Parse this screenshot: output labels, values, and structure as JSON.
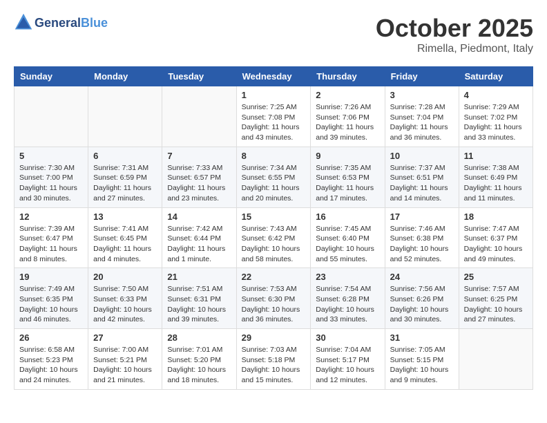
{
  "header": {
    "logo_line1": "General",
    "logo_line2": "Blue",
    "month": "October 2025",
    "location": "Rimella, Piedmont, Italy"
  },
  "weekdays": [
    "Sunday",
    "Monday",
    "Tuesday",
    "Wednesday",
    "Thursday",
    "Friday",
    "Saturday"
  ],
  "weeks": [
    [
      {
        "day": "",
        "info": ""
      },
      {
        "day": "",
        "info": ""
      },
      {
        "day": "",
        "info": ""
      },
      {
        "day": "1",
        "info": "Sunrise: 7:25 AM\nSunset: 7:08 PM\nDaylight: 11 hours and 43 minutes."
      },
      {
        "day": "2",
        "info": "Sunrise: 7:26 AM\nSunset: 7:06 PM\nDaylight: 11 hours and 39 minutes."
      },
      {
        "day": "3",
        "info": "Sunrise: 7:28 AM\nSunset: 7:04 PM\nDaylight: 11 hours and 36 minutes."
      },
      {
        "day": "4",
        "info": "Sunrise: 7:29 AM\nSunset: 7:02 PM\nDaylight: 11 hours and 33 minutes."
      }
    ],
    [
      {
        "day": "5",
        "info": "Sunrise: 7:30 AM\nSunset: 7:00 PM\nDaylight: 11 hours and 30 minutes."
      },
      {
        "day": "6",
        "info": "Sunrise: 7:31 AM\nSunset: 6:59 PM\nDaylight: 11 hours and 27 minutes."
      },
      {
        "day": "7",
        "info": "Sunrise: 7:33 AM\nSunset: 6:57 PM\nDaylight: 11 hours and 23 minutes."
      },
      {
        "day": "8",
        "info": "Sunrise: 7:34 AM\nSunset: 6:55 PM\nDaylight: 11 hours and 20 minutes."
      },
      {
        "day": "9",
        "info": "Sunrise: 7:35 AM\nSunset: 6:53 PM\nDaylight: 11 hours and 17 minutes."
      },
      {
        "day": "10",
        "info": "Sunrise: 7:37 AM\nSunset: 6:51 PM\nDaylight: 11 hours and 14 minutes."
      },
      {
        "day": "11",
        "info": "Sunrise: 7:38 AM\nSunset: 6:49 PM\nDaylight: 11 hours and 11 minutes."
      }
    ],
    [
      {
        "day": "12",
        "info": "Sunrise: 7:39 AM\nSunset: 6:47 PM\nDaylight: 11 hours and 8 minutes."
      },
      {
        "day": "13",
        "info": "Sunrise: 7:41 AM\nSunset: 6:45 PM\nDaylight: 11 hours and 4 minutes."
      },
      {
        "day": "14",
        "info": "Sunrise: 7:42 AM\nSunset: 6:44 PM\nDaylight: 11 hours and 1 minute."
      },
      {
        "day": "15",
        "info": "Sunrise: 7:43 AM\nSunset: 6:42 PM\nDaylight: 10 hours and 58 minutes."
      },
      {
        "day": "16",
        "info": "Sunrise: 7:45 AM\nSunset: 6:40 PM\nDaylight: 10 hours and 55 minutes."
      },
      {
        "day": "17",
        "info": "Sunrise: 7:46 AM\nSunset: 6:38 PM\nDaylight: 10 hours and 52 minutes."
      },
      {
        "day": "18",
        "info": "Sunrise: 7:47 AM\nSunset: 6:37 PM\nDaylight: 10 hours and 49 minutes."
      }
    ],
    [
      {
        "day": "19",
        "info": "Sunrise: 7:49 AM\nSunset: 6:35 PM\nDaylight: 10 hours and 46 minutes."
      },
      {
        "day": "20",
        "info": "Sunrise: 7:50 AM\nSunset: 6:33 PM\nDaylight: 10 hours and 42 minutes."
      },
      {
        "day": "21",
        "info": "Sunrise: 7:51 AM\nSunset: 6:31 PM\nDaylight: 10 hours and 39 minutes."
      },
      {
        "day": "22",
        "info": "Sunrise: 7:53 AM\nSunset: 6:30 PM\nDaylight: 10 hours and 36 minutes."
      },
      {
        "day": "23",
        "info": "Sunrise: 7:54 AM\nSunset: 6:28 PM\nDaylight: 10 hours and 33 minutes."
      },
      {
        "day": "24",
        "info": "Sunrise: 7:56 AM\nSunset: 6:26 PM\nDaylight: 10 hours and 30 minutes."
      },
      {
        "day": "25",
        "info": "Sunrise: 7:57 AM\nSunset: 6:25 PM\nDaylight: 10 hours and 27 minutes."
      }
    ],
    [
      {
        "day": "26",
        "info": "Sunrise: 6:58 AM\nSunset: 5:23 PM\nDaylight: 10 hours and 24 minutes."
      },
      {
        "day": "27",
        "info": "Sunrise: 7:00 AM\nSunset: 5:21 PM\nDaylight: 10 hours and 21 minutes."
      },
      {
        "day": "28",
        "info": "Sunrise: 7:01 AM\nSunset: 5:20 PM\nDaylight: 10 hours and 18 minutes."
      },
      {
        "day": "29",
        "info": "Sunrise: 7:03 AM\nSunset: 5:18 PM\nDaylight: 10 hours and 15 minutes."
      },
      {
        "day": "30",
        "info": "Sunrise: 7:04 AM\nSunset: 5:17 PM\nDaylight: 10 hours and 12 minutes."
      },
      {
        "day": "31",
        "info": "Sunrise: 7:05 AM\nSunset: 5:15 PM\nDaylight: 10 hours and 9 minutes."
      },
      {
        "day": "",
        "info": ""
      }
    ]
  ]
}
